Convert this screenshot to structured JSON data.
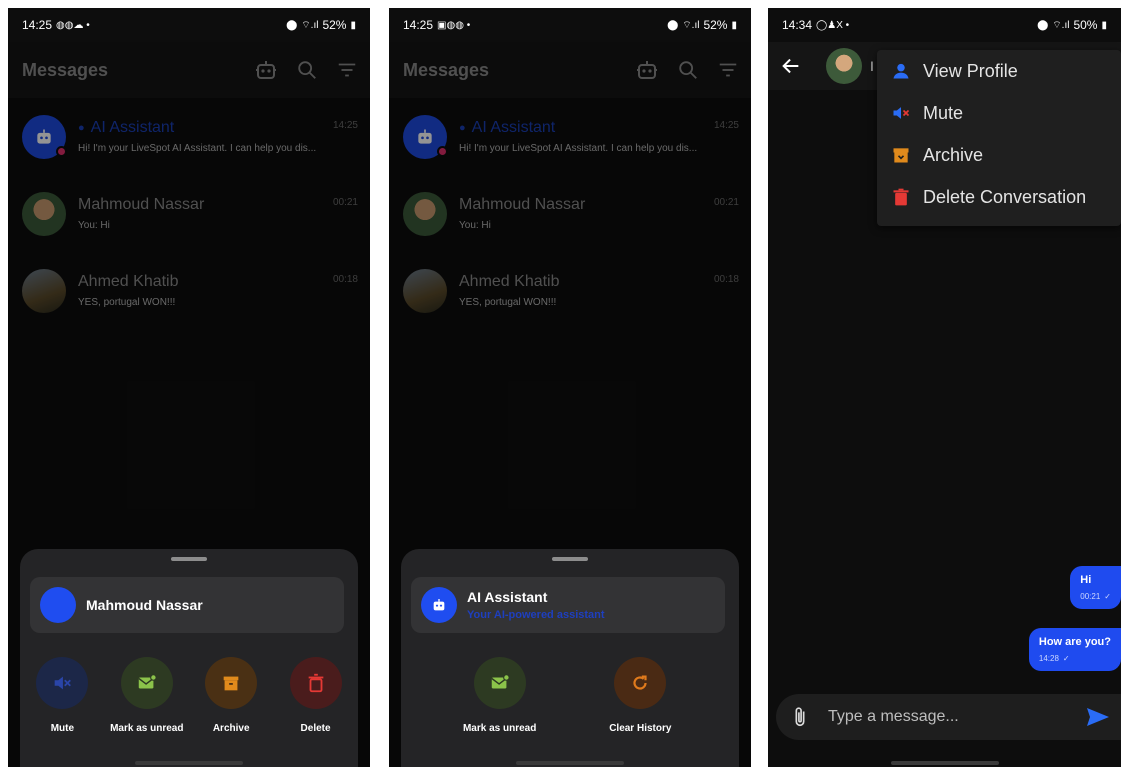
{
  "colors": {
    "accent_blue": "#1f4bef",
    "mark_unread_green": "#8bc34a",
    "archive_orange": "#e08a1c",
    "delete_red": "#e53935",
    "clear_history_orange": "#e07a1c"
  },
  "screen1": {
    "status": {
      "time": "14:25",
      "battery": "52%"
    },
    "header": {
      "title": "Messages"
    },
    "chats": [
      {
        "name": "AI Assistant",
        "preview": "Hi! I'm your LiveSpot AI Assistant. I can help you dis...",
        "time": "14:25"
      },
      {
        "name": "Mahmoud Nassar",
        "preview": "You: Hi",
        "time": "00:21"
      },
      {
        "name": "Ahmed Khatib",
        "preview": "YES, portugal WON!!!",
        "time": "00:18"
      }
    ],
    "sheet": {
      "contact_name": "Mahmoud Nassar",
      "actions": [
        {
          "label": "Mute",
          "icon": "mute-icon"
        },
        {
          "label": "Mark as unread",
          "icon": "mark-unread-icon"
        },
        {
          "label": "Archive",
          "icon": "archive-icon"
        },
        {
          "label": "Delete",
          "icon": "trash-icon"
        }
      ]
    }
  },
  "screen2": {
    "status": {
      "time": "14:25",
      "battery": "52%"
    },
    "header": {
      "title": "Messages"
    },
    "chats": [
      {
        "name": "AI Assistant",
        "preview": "Hi! I'm your LiveSpot AI Assistant. I can help you dis...",
        "time": "14:25"
      },
      {
        "name": "Mahmoud Nassar",
        "preview": "You: Hi",
        "time": "00:21"
      },
      {
        "name": "Ahmed Khatib",
        "preview": "YES, portugal WON!!!",
        "time": "00:18"
      }
    ],
    "sheet": {
      "contact_name": "AI Assistant",
      "contact_subtitle": "Your AI-powered assistant",
      "actions": [
        {
          "label": "Mark as unread",
          "icon": "mark-unread-icon"
        },
        {
          "label": "Clear History",
          "icon": "refresh-icon"
        }
      ]
    }
  },
  "screen3": {
    "status": {
      "time": "14:34",
      "battery": "50%"
    },
    "header": {
      "name_initial": "I"
    },
    "menu": [
      {
        "label": "View Profile",
        "icon": "person-icon"
      },
      {
        "label": "Mute",
        "icon": "mute-icon"
      },
      {
        "label": "Archive",
        "icon": "archive-icon"
      },
      {
        "label": "Delete Conversation",
        "icon": "trash-icon"
      }
    ],
    "messages": [
      {
        "text": "Hi",
        "time": "00:21"
      },
      {
        "text": "How are you?",
        "time": "14:28"
      }
    ],
    "composer": {
      "placeholder": "Type a message..."
    }
  }
}
